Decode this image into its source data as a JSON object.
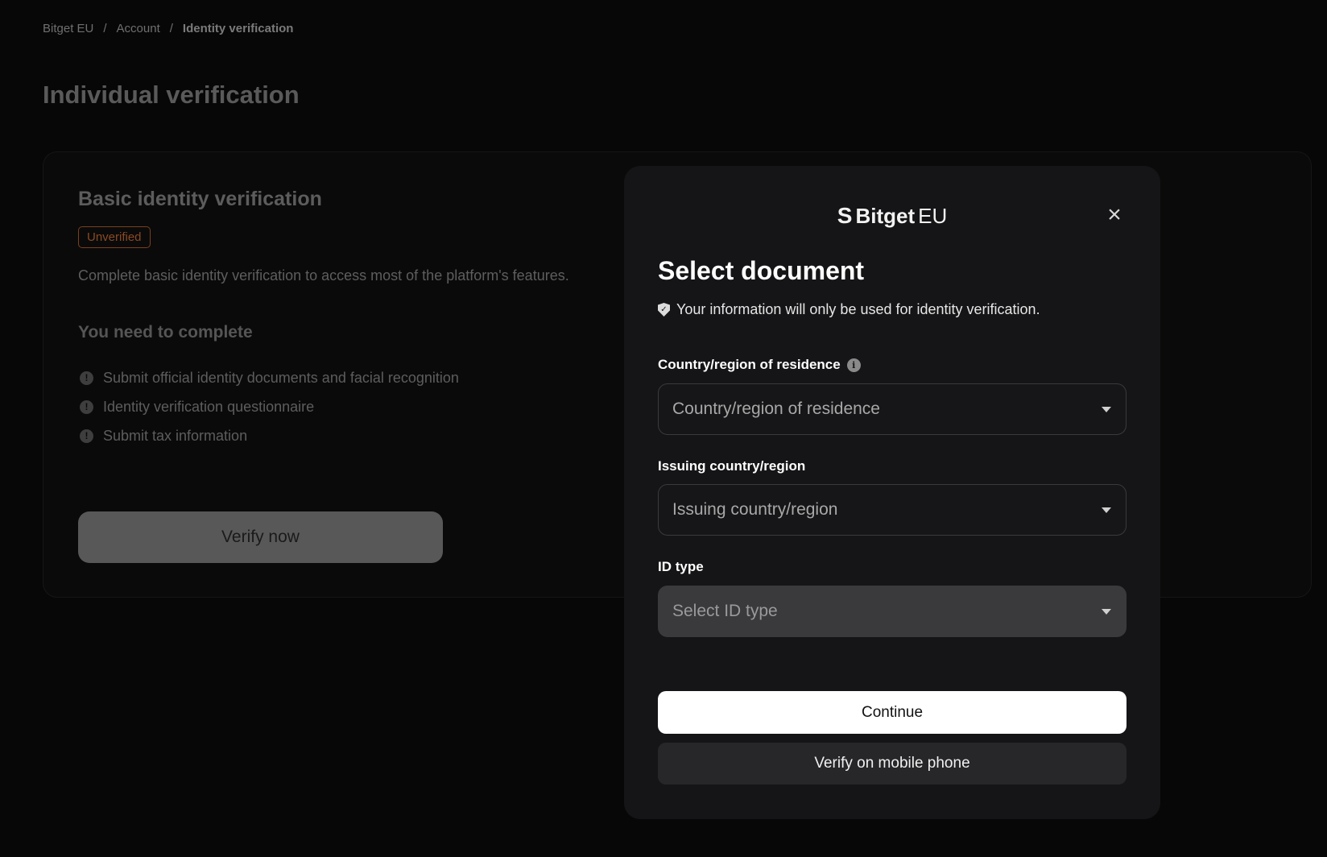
{
  "breadcrumb": {
    "items": [
      "Bitget EU",
      "Account",
      "Identity verification"
    ],
    "separator": "/"
  },
  "page": {
    "title": "Individual verification"
  },
  "basic_card": {
    "title": "Basic identity verification",
    "status_badge": "Unverified",
    "description": "Complete basic identity verification to access most of the platform's features.",
    "requirements_title": "You need to complete",
    "requirements": [
      "Submit official identity documents and facial recognition",
      "Identity verification questionnaire",
      "Submit tax information"
    ],
    "verify_button": "Verify now"
  },
  "modal": {
    "logo_mark": "S",
    "logo_brand": "Bitget",
    "logo_region": "EU",
    "close_symbol": "×",
    "title": "Select document",
    "notice": "Your information will only be used for identity verification.",
    "fields": {
      "residence": {
        "label": "Country/region of residence",
        "placeholder": "Country/region of residence"
      },
      "issuing": {
        "label": "Issuing country/region",
        "placeholder": "Issuing country/region"
      },
      "id_type": {
        "label": "ID type",
        "placeholder": "Select ID type"
      }
    },
    "continue_button": "Continue",
    "mobile_button": "Verify on mobile phone"
  },
  "icons": {
    "requirement": "exclamation-circle-icon",
    "notice": "shield-check-icon",
    "field_info": "info-icon",
    "dropdown": "caret-down-icon",
    "close": "close-icon"
  },
  "colors": {
    "background": "#070707",
    "modal_bg": "#151517",
    "badge_border": "#7a3f1e",
    "primary_button": "#ffffff",
    "secondary_button": "#27272a"
  }
}
